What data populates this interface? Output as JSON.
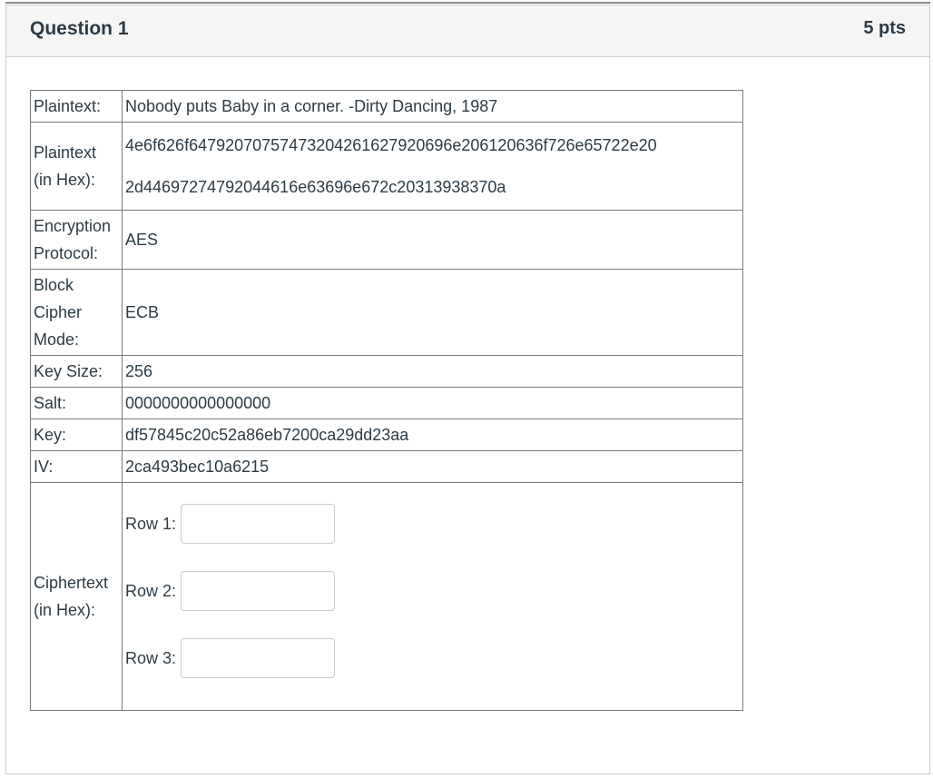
{
  "question": {
    "title": "Question 1",
    "points": "5 pts"
  },
  "rows": {
    "plaintext": {
      "label": "Plaintext:",
      "value": "Nobody puts Baby in a corner. -Dirty Dancing, 1987"
    },
    "plaintext_hex": {
      "label_line1": "Plaintext",
      "label_line2": "(in Hex):",
      "line1": "4e6f626f6479207075747320426162792069 6e206120636f726e65722e20",
      "line2": "2d4469727479204461 6e63696e672c20313938370a"
    },
    "protocol": {
      "label_line1": "Encryption",
      "label_line2": "Protocol:",
      "value": "AES"
    },
    "mode": {
      "label_line1": "Block",
      "label_line2": "Cipher",
      "label_line3": "Mode:",
      "value": "ECB"
    },
    "key_size": {
      "label": "Key Size:",
      "value": "256"
    },
    "salt": {
      "label": "Salt:",
      "value": "0000000000000000"
    },
    "key": {
      "label": "Key:",
      "value": "df57845c20c52a86eb7200ca29dd23aa"
    },
    "iv": {
      "label": "IV:",
      "value": "2ca493bec10a6215"
    },
    "ciphertext": {
      "label_line1": "Ciphertext",
      "label_line2": "(in Hex):",
      "row1_label": "Row 1:",
      "row2_label": "Row 2:",
      "row3_label": "Row 3:",
      "row1_value": "",
      "row2_value": "",
      "row3_value": ""
    }
  }
}
